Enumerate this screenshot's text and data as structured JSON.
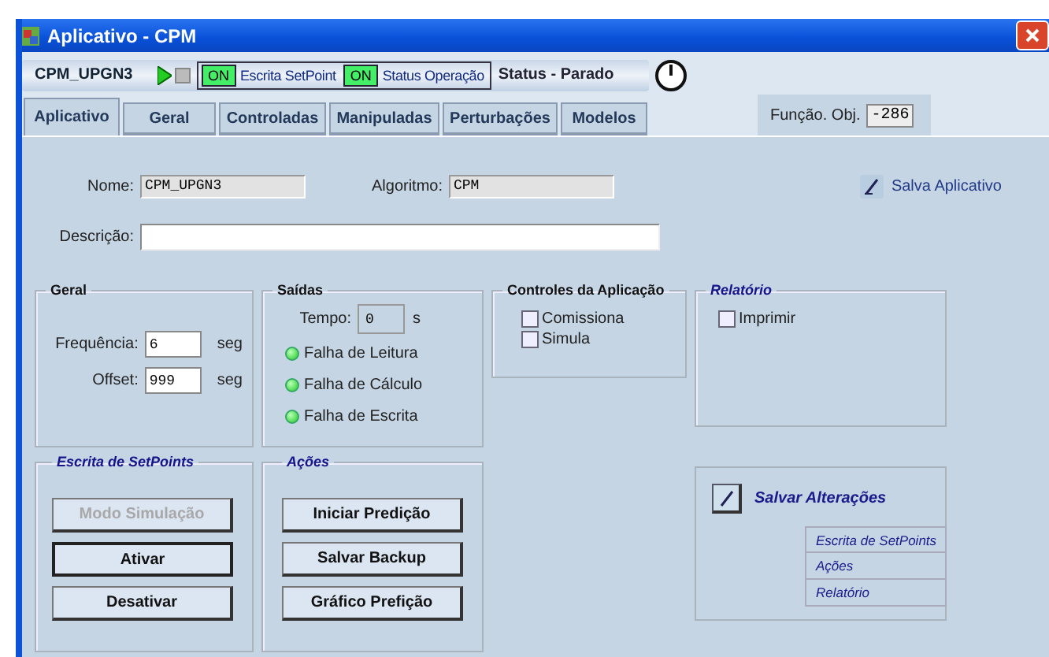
{
  "window": {
    "title": "Aplicativo - CPM"
  },
  "toolbar": {
    "app_name": "CPM_UPGN3",
    "indicators": [
      {
        "badge": "ON",
        "label": "Escrita SetPoint",
        "on": true
      },
      {
        "badge": "ON",
        "label": "Status Operação",
        "on": true
      }
    ],
    "status": "Status - Parado"
  },
  "tabs": [
    {
      "label": "Aplicativo",
      "selected": true
    },
    {
      "label": "Geral",
      "selected": false
    },
    {
      "label": "Controladas",
      "selected": false
    },
    {
      "label": "Manipuladas",
      "selected": false
    },
    {
      "label": "Perturbações",
      "selected": false
    },
    {
      "label": "Modelos",
      "selected": false
    }
  ],
  "objective": {
    "label": "Função. Obj.",
    "value": "-286"
  },
  "nome": {
    "label": "Nome:",
    "value": "CPM_UPGN3"
  },
  "algoritmo": {
    "label": "Algoritmo:",
    "value": "CPM"
  },
  "save_app": {
    "label": "Salva Aplicativo"
  },
  "descricao": {
    "label": "Descrição:"
  },
  "geral": {
    "title": "Geral",
    "kind": "plain",
    "fields": [
      {
        "label": "Frequência:",
        "value": "6",
        "unit": "seg"
      },
      {
        "label": "Offset:",
        "value": "999",
        "unit": "seg"
      }
    ]
  },
  "saidas": {
    "title": "Saídas",
    "kind": "plain",
    "tempo": {
      "label": "Tempo:",
      "value": "0",
      "unit": "s"
    },
    "indicators": [
      {
        "label": "Falha de Leitura",
        "lit": true
      },
      {
        "label": "Falha de Cálculo",
        "lit": true
      },
      {
        "label": "Falha de Escrita",
        "lit": true
      }
    ]
  },
  "controles": {
    "title": "Controles da Aplicação",
    "kind": "plain",
    "options": [
      {
        "label": "Comissiona",
        "checked": false
      },
      {
        "label": "Simula",
        "checked": false
      }
    ]
  },
  "relatorio": {
    "title": "Relatório",
    "kind": "accent",
    "options": [
      {
        "label": "Imprimir",
        "checked": false
      }
    ]
  },
  "escrita": {
    "title": "Escrita de SetPoints",
    "kind": "accent",
    "buttons": [
      {
        "label": "Modo Simulação",
        "disabled": true,
        "focused": false
      },
      {
        "label": "Ativar",
        "disabled": false,
        "focused": true
      },
      {
        "label": "Desativar",
        "disabled": false,
        "focused": false
      }
    ]
  },
  "acoes": {
    "title": "Ações",
    "kind": "accent",
    "buttons": [
      {
        "label": "Iniciar Predição",
        "disabled": false,
        "focused": false
      },
      {
        "label": "Salvar Backup",
        "disabled": false,
        "focused": false
      },
      {
        "label": "Gráfico Prefição",
        "disabled": false,
        "focused": false
      }
    ]
  },
  "salvar": {
    "label": "Salvar Alterações",
    "links": [
      "Escrita de SetPoints",
      "Ações",
      "Relatório"
    ]
  }
}
